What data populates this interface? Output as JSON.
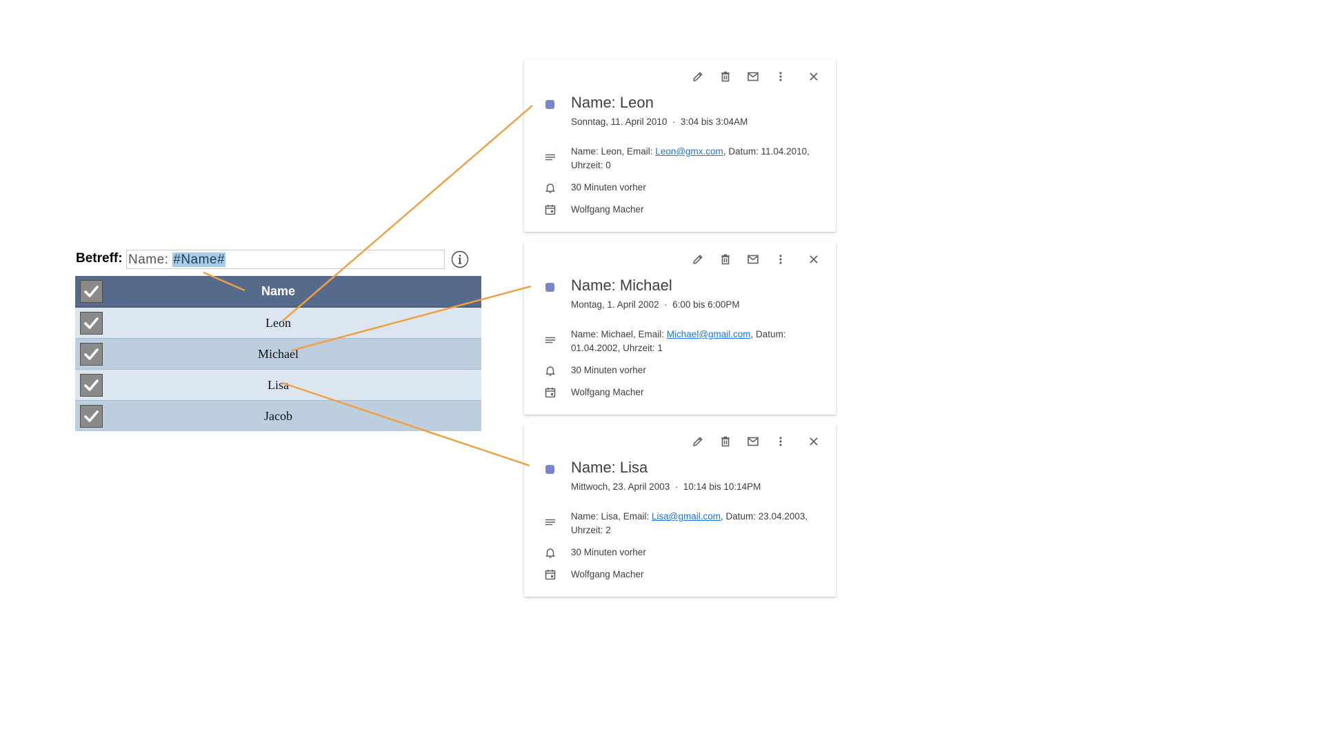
{
  "form": {
    "subject_label": "Betreff:",
    "subject_prefix": "Name: ",
    "subject_token": "#Name#"
  },
  "table": {
    "header": "Name",
    "rows": [
      "Leon",
      "Michael",
      "Lisa",
      "Jacob"
    ]
  },
  "icons": {
    "info": "info-circle-icon",
    "check": "checkmark-icon",
    "edit": "pencil-icon",
    "delete": "trash-icon",
    "email": "envelope-icon",
    "more": "more-vert-icon",
    "close": "close-icon",
    "description": "notes-icon",
    "reminder": "bell-icon",
    "calendar": "calendar-icon"
  },
  "colors": {
    "header_bg": "#566b8c",
    "row_light": "#dce6f0",
    "row_dark": "#bdcfdf",
    "event_dot": "#7986cb",
    "connector": "#f0a040",
    "link": "#1a73e8"
  },
  "events": [
    {
      "title": "Name: Leon",
      "date": "Sonntag, 11. April 2010",
      "time": "3:04 bis 3:04AM",
      "desc_pre": "Name: Leon, Email: ",
      "email": "Leon@gmx.com",
      "desc_post": ", Datum: 11.04.2010, Uhrzeit: 0",
      "reminder": "30 Minuten vorher",
      "calendar": "Wolfgang Macher"
    },
    {
      "title": "Name: Michael",
      "date": "Montag, 1. April 2002",
      "time": "6:00 bis 6:00PM",
      "desc_pre": "Name: Michael, Email: ",
      "email": "Michael@gmail.com",
      "desc_post": ", Datum: 01.04.2002, Uhrzeit: 1",
      "reminder": "30 Minuten vorher",
      "calendar": "Wolfgang Macher"
    },
    {
      "title": "Name: Lisa",
      "date": "Mittwoch, 23. April 2003",
      "time": "10:14 bis 10:14PM",
      "desc_pre": "Name: Lisa, Email: ",
      "email": "Lisa@gmail.com",
      "desc_post": ", Datum: 23.04.2003, Uhrzeit: 2",
      "reminder": "30 Minuten vorher",
      "calendar": "Wolfgang Macher"
    }
  ]
}
